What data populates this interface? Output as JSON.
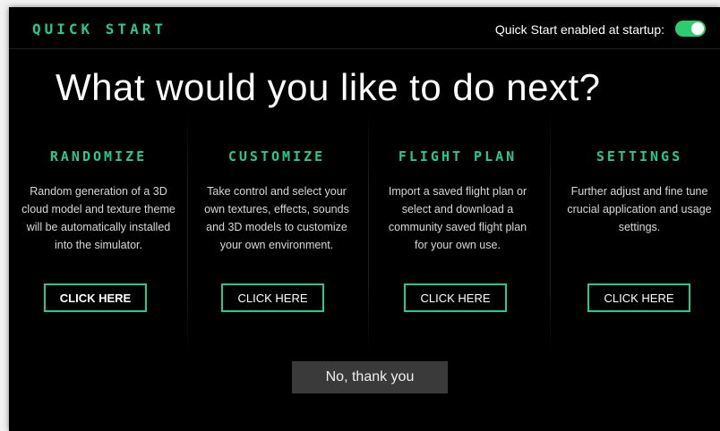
{
  "app_title": "QUICK START",
  "startup": {
    "label": "Quick Start enabled at startup:",
    "enabled": true
  },
  "headline": "What would you like to do next?",
  "options": [
    {
      "title": "RANDOMIZE",
      "description": "Random generation of a 3D cloud model and texture theme will be automatically installed into the simulator.",
      "button": "CLICK HERE"
    },
    {
      "title": "CUSTOMIZE",
      "description": "Take control and select your own textures, effects, sounds and 3D models to customize your own environment.",
      "button": "CLICK HERE"
    },
    {
      "title": "FLIGHT PLAN",
      "description": "Import a saved flight plan or select and download a community saved flight plan for your own use.",
      "button": "CLICK HERE"
    },
    {
      "title": "SETTINGS",
      "description": "Further adjust and fine tune crucial application and usage settings.",
      "button": "CLICK HERE"
    }
  ],
  "decline_button": "No, thank you",
  "colors": {
    "accent": "#29c98a",
    "toggle_on": "#2ecc71",
    "background": "#000000",
    "decline_bg": "#3a3a3a"
  }
}
